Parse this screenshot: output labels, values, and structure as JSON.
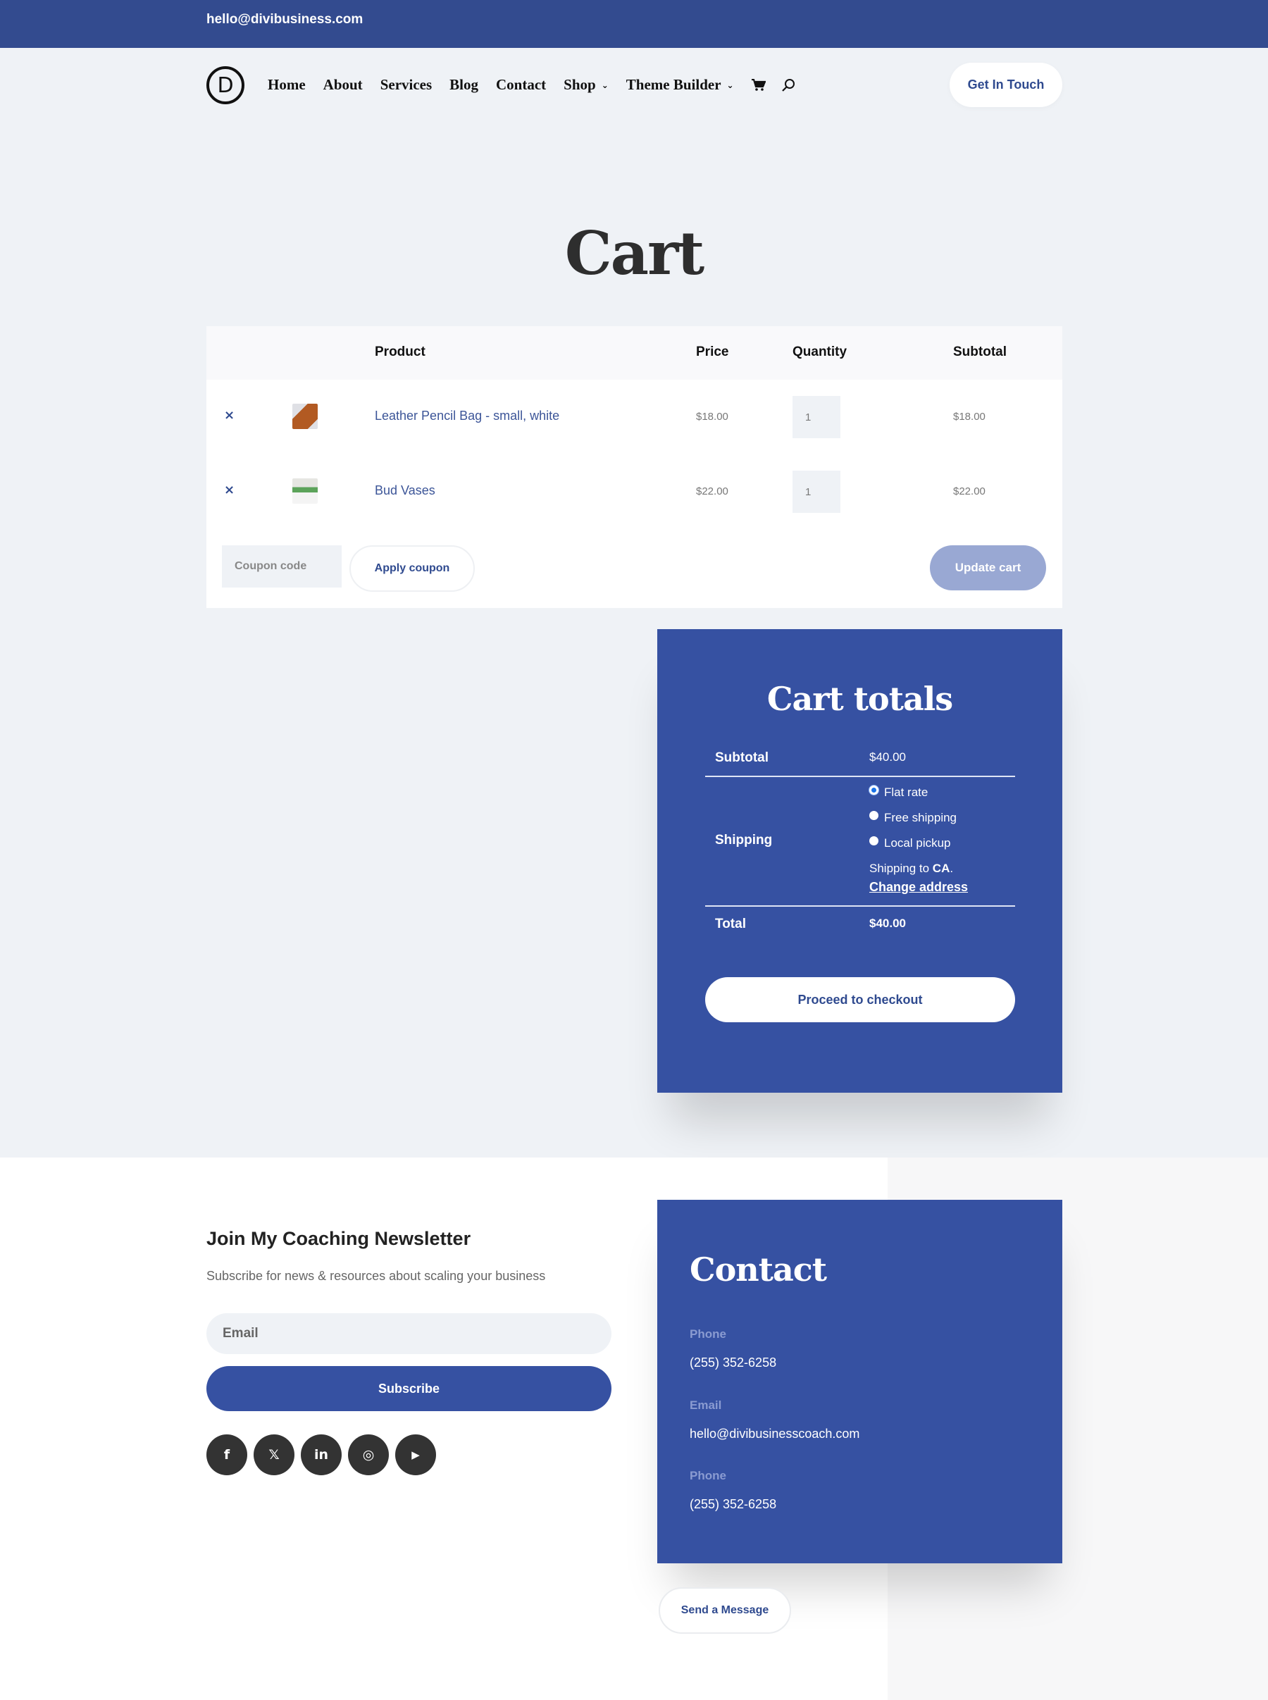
{
  "topbar": {
    "email": "hello@divibusiness.com"
  },
  "header": {
    "logo_letter": "D",
    "nav": [
      {
        "label": "Home",
        "has_dropdown": false
      },
      {
        "label": "About",
        "has_dropdown": false
      },
      {
        "label": "Services",
        "has_dropdown": false
      },
      {
        "label": "Blog",
        "has_dropdown": false
      },
      {
        "label": "Contact",
        "has_dropdown": false
      },
      {
        "label": "Shop",
        "has_dropdown": true
      },
      {
        "label": "Theme Builder",
        "has_dropdown": true
      }
    ],
    "chevron": "⌄",
    "cta_label": "Get In Touch"
  },
  "page": {
    "title": "Cart"
  },
  "cart": {
    "headers": {
      "product": "Product",
      "price": "Price",
      "quantity": "Quantity",
      "subtotal": "Subtotal"
    },
    "remove_glyph": "×",
    "items": [
      {
        "name": "Leather Pencil Bag - small, white",
        "price": "$18.00",
        "quantity": "1",
        "subtotal": "$18.00"
      },
      {
        "name": "Bud Vases",
        "price": "$22.00",
        "quantity": "1",
        "subtotal": "$22.00"
      }
    ],
    "coupon_placeholder": "Coupon code",
    "apply_coupon_label": "Apply coupon",
    "update_cart_label": "Update cart"
  },
  "totals": {
    "title": "Cart totals",
    "subtotal_label": "Subtotal",
    "subtotal_value": "$40.00",
    "shipping_label": "Shipping",
    "shipping_options": [
      {
        "label": "Flat rate",
        "checked": true
      },
      {
        "label": "Free shipping",
        "checked": false
      },
      {
        "label": "Local pickup",
        "checked": false
      }
    ],
    "shipping_to_prefix": "Shipping to ",
    "shipping_to_region": "CA",
    "shipping_to_suffix": ".",
    "change_address_label": "Change address",
    "total_label": "Total",
    "total_value": "$40.00",
    "checkout_label": "Proceed to checkout"
  },
  "newsletter": {
    "title": "Join My Coaching Newsletter",
    "subtitle": "Subscribe for news & resources about scaling your business",
    "email_placeholder": "Email",
    "subscribe_label": "Subscribe",
    "socials": [
      {
        "name": "facebook",
        "glyph": "f"
      },
      {
        "name": "x",
        "glyph": "𝕏"
      },
      {
        "name": "linkedin",
        "glyph": "in"
      },
      {
        "name": "instagram",
        "glyph": "◎"
      },
      {
        "name": "youtube",
        "glyph": "▶"
      }
    ]
  },
  "contact": {
    "title": "Contact",
    "items": [
      {
        "label": "Phone",
        "value": "(255) 352-6258"
      },
      {
        "label": "Email",
        "value": "hello@divibusinesscoach.com"
      },
      {
        "label": "Phone",
        "value": "(255) 352-6258"
      }
    ],
    "send_message_label": "Send a Message"
  },
  "colors": {
    "brand_blue": "#3651a2",
    "topbar_blue": "#334b8f",
    "update_disabled": "#99a8d3",
    "page_bg": "#eff2f6"
  }
}
